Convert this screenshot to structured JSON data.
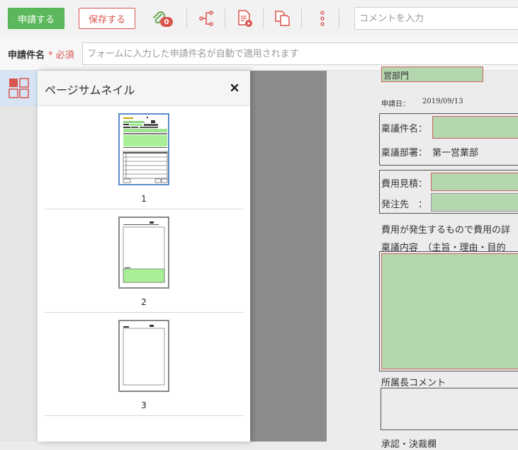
{
  "toolbar": {
    "apply_label": "申請する",
    "save_label": "保存する",
    "attachment_count": "0",
    "comment_placeholder": "コメントを入力",
    "accent_green": "#5cb85c",
    "accent_red": "#d9534f",
    "icons": [
      "paperclip-icon",
      "route-icon",
      "document-play-icon",
      "copy-icon",
      "more-vertical-icon"
    ]
  },
  "title_row": {
    "label": "申請件名",
    "required_mark": "* 必須",
    "placeholder": "フォームに入力した申請件名が自動で適用されます"
  },
  "thumbnail_panel": {
    "title": "ページサムネイル",
    "pages": [
      {
        "number": "1",
        "selected": true
      },
      {
        "number": "2",
        "selected": false
      },
      {
        "number": "3",
        "selected": false
      }
    ]
  },
  "document": {
    "dept_field_fragment": "営部門",
    "date_label": "申請日：",
    "date_value": "2019/09/13",
    "proposal_name_label": "稟議件名：",
    "proposal_dept_label": "稟議部署：",
    "proposal_dept_value": "第一営業部",
    "estimate_label": "費用見積：",
    "supplier_label": "発注先　：",
    "cost_note": "費用が発生するもので費用の詳",
    "content_label": "稟議内容　（主旨・理由・目的",
    "manager_comment_label": "所属長コメント",
    "footer_fragment": "承認・決裁欄"
  }
}
